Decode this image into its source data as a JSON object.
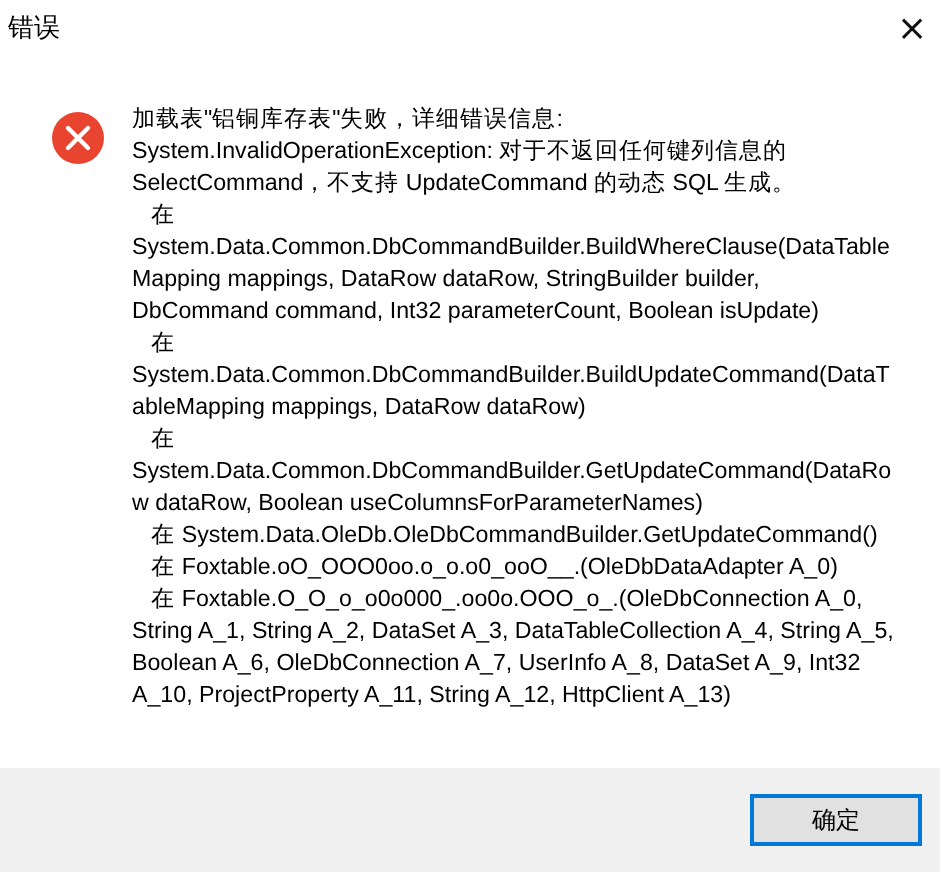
{
  "window": {
    "title": "错误",
    "close": "×"
  },
  "message": {
    "lines": [
      "加载表\"铝铜库存表\"失败，详细错误信息:",
      "System.InvalidOperationException: 对于不返回任何键列信息的",
      "SelectCommand，不支持 UpdateCommand 的动态 SQL 生成。",
      "   在",
      "System.Data.Common.DbCommandBuilder.BuildWhereClause(DataTable",
      "Mapping mappings, DataRow dataRow, StringBuilder builder,",
      "DbCommand command, Int32 parameterCount, Boolean isUpdate)",
      "   在",
      "System.Data.Common.DbCommandBuilder.BuildUpdateCommand(DataT",
      "ableMapping mappings, DataRow dataRow)",
      "   在",
      "System.Data.Common.DbCommandBuilder.GetUpdateCommand(DataRo",
      "w dataRow, Boolean useColumnsForParameterNames)",
      "   在 System.Data.OleDb.OleDbCommandBuilder.GetUpdateCommand()",
      "   在 Foxtable.oO_OOO0oo.o_o.o0_ooO__.(OleDbDataAdapter A_0)",
      "   在 Foxtable.O_O_o_o0o000_.oo0o.OOO_o_.(OleDbConnection A_0,",
      "String A_1, String A_2, DataSet A_3, DataTableCollection A_4, String A_5,",
      "Boolean A_6, OleDbConnection A_7, UserInfo A_8, DataSet A_9, Int32",
      "A_10, ProjectProperty A_11, String A_12, HttpClient A_13)"
    ]
  },
  "buttons": [
    {
      "label": "确定",
      "selected": true
    }
  ]
}
